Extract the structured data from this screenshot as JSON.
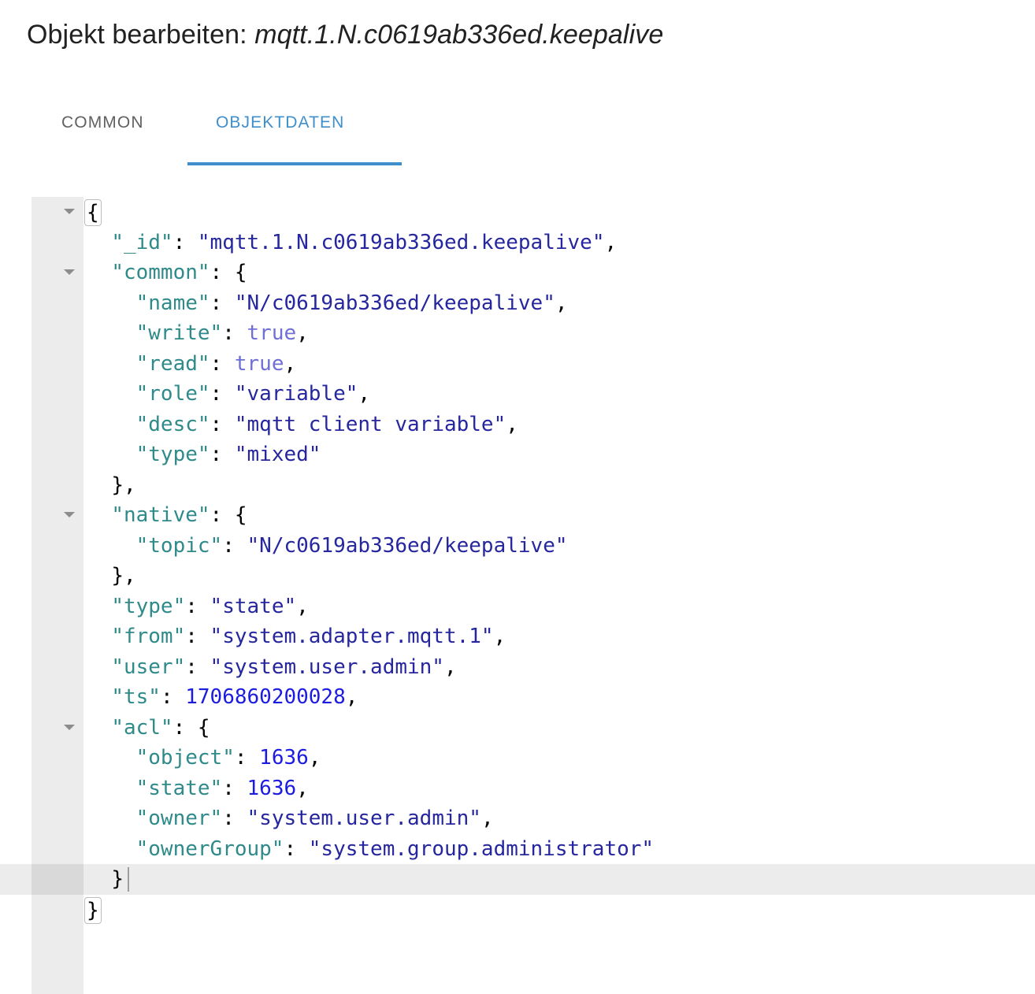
{
  "header": {
    "title_prefix": "Objekt bearbeiten: ",
    "object_id": "mqtt.1.N.c0619ab336ed.keepalive"
  },
  "tabs": [
    {
      "label": "COMMON",
      "active": false
    },
    {
      "label": "OBJEKTDATEN",
      "active": true
    }
  ],
  "colors": {
    "accent": "#3f8fcc",
    "inactive_tab": "#616161",
    "gutter": "#ececec",
    "active_line": "#ececec",
    "active_gutter": "#d9d9d9",
    "key": "#2f8a8a",
    "string": "#26269e",
    "boolean": "#6f6fd8",
    "number": "#1c1ce0",
    "punctuation": "#000000"
  },
  "editor": {
    "language": "json",
    "active_line_index": 22,
    "caret_visible": true,
    "lines": [
      {
        "indent": 0,
        "fold": true,
        "bracket_highlight": true,
        "tokens": [
          {
            "t": "{",
            "c": "p"
          }
        ]
      },
      {
        "indent": 1,
        "fold": false,
        "tokens": [
          {
            "t": "\"_id\"",
            "c": "k"
          },
          {
            "t": ": ",
            "c": "p"
          },
          {
            "t": "\"mqtt.1.N.c0619ab336ed.keepalive\"",
            "c": "s"
          },
          {
            "t": ",",
            "c": "p"
          }
        ]
      },
      {
        "indent": 1,
        "fold": true,
        "tokens": [
          {
            "t": "\"common\"",
            "c": "k"
          },
          {
            "t": ": {",
            "c": "p"
          }
        ]
      },
      {
        "indent": 2,
        "fold": false,
        "tokens": [
          {
            "t": "\"name\"",
            "c": "k"
          },
          {
            "t": ": ",
            "c": "p"
          },
          {
            "t": "\"N/c0619ab336ed/keepalive\"",
            "c": "s"
          },
          {
            "t": ",",
            "c": "p"
          }
        ]
      },
      {
        "indent": 2,
        "fold": false,
        "tokens": [
          {
            "t": "\"write\"",
            "c": "k"
          },
          {
            "t": ": ",
            "c": "p"
          },
          {
            "t": "true",
            "c": "b"
          },
          {
            "t": ",",
            "c": "p"
          }
        ]
      },
      {
        "indent": 2,
        "fold": false,
        "tokens": [
          {
            "t": "\"read\"",
            "c": "k"
          },
          {
            "t": ": ",
            "c": "p"
          },
          {
            "t": "true",
            "c": "b"
          },
          {
            "t": ",",
            "c": "p"
          }
        ]
      },
      {
        "indent": 2,
        "fold": false,
        "tokens": [
          {
            "t": "\"role\"",
            "c": "k"
          },
          {
            "t": ": ",
            "c": "p"
          },
          {
            "t": "\"variable\"",
            "c": "s"
          },
          {
            "t": ",",
            "c": "p"
          }
        ]
      },
      {
        "indent": 2,
        "fold": false,
        "tokens": [
          {
            "t": "\"desc\"",
            "c": "k"
          },
          {
            "t": ": ",
            "c": "p"
          },
          {
            "t": "\"mqtt client variable\"",
            "c": "s"
          },
          {
            "t": ",",
            "c": "p"
          }
        ]
      },
      {
        "indent": 2,
        "fold": false,
        "tokens": [
          {
            "t": "\"type\"",
            "c": "k"
          },
          {
            "t": ": ",
            "c": "p"
          },
          {
            "t": "\"mixed\"",
            "c": "s"
          }
        ]
      },
      {
        "indent": 1,
        "fold": false,
        "tokens": [
          {
            "t": "},",
            "c": "p"
          }
        ]
      },
      {
        "indent": 1,
        "fold": true,
        "tokens": [
          {
            "t": "\"native\"",
            "c": "k"
          },
          {
            "t": ": {",
            "c": "p"
          }
        ]
      },
      {
        "indent": 2,
        "fold": false,
        "tokens": [
          {
            "t": "\"topic\"",
            "c": "k"
          },
          {
            "t": ": ",
            "c": "p"
          },
          {
            "t": "\"N/c0619ab336ed/keepalive\"",
            "c": "s"
          }
        ]
      },
      {
        "indent": 1,
        "fold": false,
        "tokens": [
          {
            "t": "},",
            "c": "p"
          }
        ]
      },
      {
        "indent": 1,
        "fold": false,
        "tokens": [
          {
            "t": "\"type\"",
            "c": "k"
          },
          {
            "t": ": ",
            "c": "p"
          },
          {
            "t": "\"state\"",
            "c": "s"
          },
          {
            "t": ",",
            "c": "p"
          }
        ]
      },
      {
        "indent": 1,
        "fold": false,
        "tokens": [
          {
            "t": "\"from\"",
            "c": "k"
          },
          {
            "t": ": ",
            "c": "p"
          },
          {
            "t": "\"system.adapter.mqtt.1\"",
            "c": "s"
          },
          {
            "t": ",",
            "c": "p"
          }
        ]
      },
      {
        "indent": 1,
        "fold": false,
        "tokens": [
          {
            "t": "\"user\"",
            "c": "k"
          },
          {
            "t": ": ",
            "c": "p"
          },
          {
            "t": "\"system.user.admin\"",
            "c": "s"
          },
          {
            "t": ",",
            "c": "p"
          }
        ]
      },
      {
        "indent": 1,
        "fold": false,
        "tokens": [
          {
            "t": "\"ts\"",
            "c": "k"
          },
          {
            "t": ": ",
            "c": "p"
          },
          {
            "t": "1706860200028",
            "c": "n"
          },
          {
            "t": ",",
            "c": "p"
          }
        ]
      },
      {
        "indent": 1,
        "fold": true,
        "tokens": [
          {
            "t": "\"acl\"",
            "c": "k"
          },
          {
            "t": ": {",
            "c": "p"
          }
        ]
      },
      {
        "indent": 2,
        "fold": false,
        "tokens": [
          {
            "t": "\"object\"",
            "c": "k"
          },
          {
            "t": ": ",
            "c": "p"
          },
          {
            "t": "1636",
            "c": "n"
          },
          {
            "t": ",",
            "c": "p"
          }
        ]
      },
      {
        "indent": 2,
        "fold": false,
        "tokens": [
          {
            "t": "\"state\"",
            "c": "k"
          },
          {
            "t": ": ",
            "c": "p"
          },
          {
            "t": "1636",
            "c": "n"
          },
          {
            "t": ",",
            "c": "p"
          }
        ]
      },
      {
        "indent": 2,
        "fold": false,
        "tokens": [
          {
            "t": "\"owner\"",
            "c": "k"
          },
          {
            "t": ": ",
            "c": "p"
          },
          {
            "t": "\"system.user.admin\"",
            "c": "s"
          },
          {
            "t": ",",
            "c": "p"
          }
        ]
      },
      {
        "indent": 2,
        "fold": false,
        "tokens": [
          {
            "t": "\"ownerGroup\"",
            "c": "k"
          },
          {
            "t": ": ",
            "c": "p"
          },
          {
            "t": "\"system.group.administrator\"",
            "c": "s"
          }
        ]
      },
      {
        "indent": 1,
        "fold": false,
        "tokens": [
          {
            "t": "}",
            "c": "p"
          }
        ]
      },
      {
        "indent": 0,
        "fold": false,
        "bracket_highlight": true,
        "tokens": [
          {
            "t": "}",
            "c": "p"
          }
        ]
      }
    ]
  }
}
